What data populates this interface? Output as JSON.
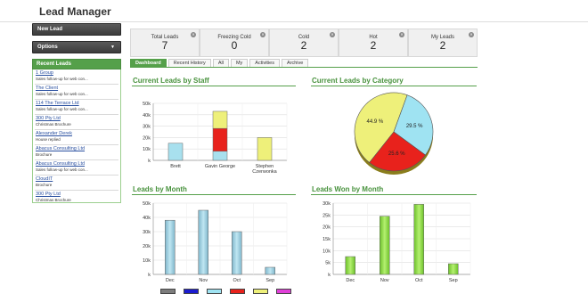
{
  "header": {
    "title": "Lead Manager"
  },
  "sidebar": {
    "new_lead": "New Lead",
    "options": "Options",
    "recent_title": "Recent Leads",
    "recent": [
      {
        "title": "1 Group",
        "sub": "Sales follow-up for web con..."
      },
      {
        "title": "The Client",
        "sub": "Sales follow-up for web con..."
      },
      {
        "title": "114 The Terrace Ltd",
        "sub": "Sales follow-up for web con..."
      },
      {
        "title": "300 Pty Ltd",
        "sub": "Christmas Brochure"
      },
      {
        "title": "Alexander Derek",
        "sub": "House replied"
      },
      {
        "title": "Abacus Consulting Ltd",
        "sub": "Brochure"
      },
      {
        "title": "Abacus Consulting Ltd",
        "sub": "Sales follow-up for web con..."
      },
      {
        "title": "CloudIT",
        "sub": "Brochure"
      },
      {
        "title": "300 Pty Ltd",
        "sub": "Christmas Brochure"
      }
    ]
  },
  "stats": [
    {
      "label": "Total Leads",
      "value": "7"
    },
    {
      "label": "Freezing Cold",
      "value": "0"
    },
    {
      "label": "Cold",
      "value": "2"
    },
    {
      "label": "Hot",
      "value": "2"
    },
    {
      "label": "My Leads",
      "value": "2"
    }
  ],
  "tabs": [
    "Dashboard",
    "Recent History",
    "All",
    "My",
    "Activities",
    "Archive"
  ],
  "sections": {
    "staff": "Current Leads by Staff",
    "category": "Current Leads by Category",
    "month": "Leads by Month",
    "won": "Leads Won by Month"
  },
  "colors": {
    "brand_green": "#55a04a",
    "blue_bar": "#8ec8de",
    "green_bar": "#88d940",
    "red": "#e8221c",
    "yellow": "#eef07a",
    "cyan": "#9fe3f2"
  },
  "chart_data": [
    {
      "type": "bar",
      "title": "Current Leads by Staff",
      "categories": [
        "Brett",
        "Gavin George",
        "Stephen Czerwonka"
      ],
      "series": [
        {
          "name": "",
          "color": "#a8e0ee",
          "values": [
            15000,
            8000,
            0
          ]
        },
        {
          "name": "",
          "color": "#e8221c",
          "values": [
            0,
            20000,
            0
          ]
        },
        {
          "name": "",
          "color": "#eef07a",
          "values": [
            0,
            15000,
            20000
          ]
        }
      ],
      "ylim": [
        0,
        50000
      ],
      "yticks": [
        "k",
        "10k",
        "20k",
        "30k",
        "40k",
        "50k"
      ],
      "stacked": true
    },
    {
      "type": "pie",
      "title": "Current Leads by Category",
      "slices": [
        {
          "label": "44.9 %",
          "value": 44.9,
          "color": "#eef07a"
        },
        {
          "label": "29.5 %",
          "value": 29.5,
          "color": "#9fe3f2"
        },
        {
          "label": "25.6 %",
          "value": 25.6,
          "color": "#e8221c"
        }
      ]
    },
    {
      "type": "bar",
      "title": "Leads by Month",
      "categories": [
        "Dec",
        "Nov",
        "Oct",
        "Sep"
      ],
      "values": [
        38000,
        45000,
        30000,
        5000
      ],
      "ylim": [
        0,
        50000
      ],
      "yticks": [
        "k",
        "10k",
        "20k",
        "30k",
        "40k",
        "50k"
      ],
      "color": "#8ec8de"
    },
    {
      "type": "bar",
      "title": "Leads Won by Month",
      "categories": [
        "Dec",
        "Nov",
        "Oct",
        "Sep"
      ],
      "values": [
        7500,
        24500,
        29500,
        4500
      ],
      "ylim": [
        0,
        30000
      ],
      "yticks": [
        "k",
        "5k",
        "10k",
        "15k",
        "20k",
        "25k",
        "30k"
      ],
      "color": "#88d940"
    }
  ],
  "legend": [
    {
      "color": "#7d7d7d"
    },
    {
      "color": "#1b1bd0"
    },
    {
      "color": "#9fe3f2"
    },
    {
      "color": "#e8221c"
    },
    {
      "color": "#eef07a"
    },
    {
      "color": "#e040d8"
    }
  ]
}
